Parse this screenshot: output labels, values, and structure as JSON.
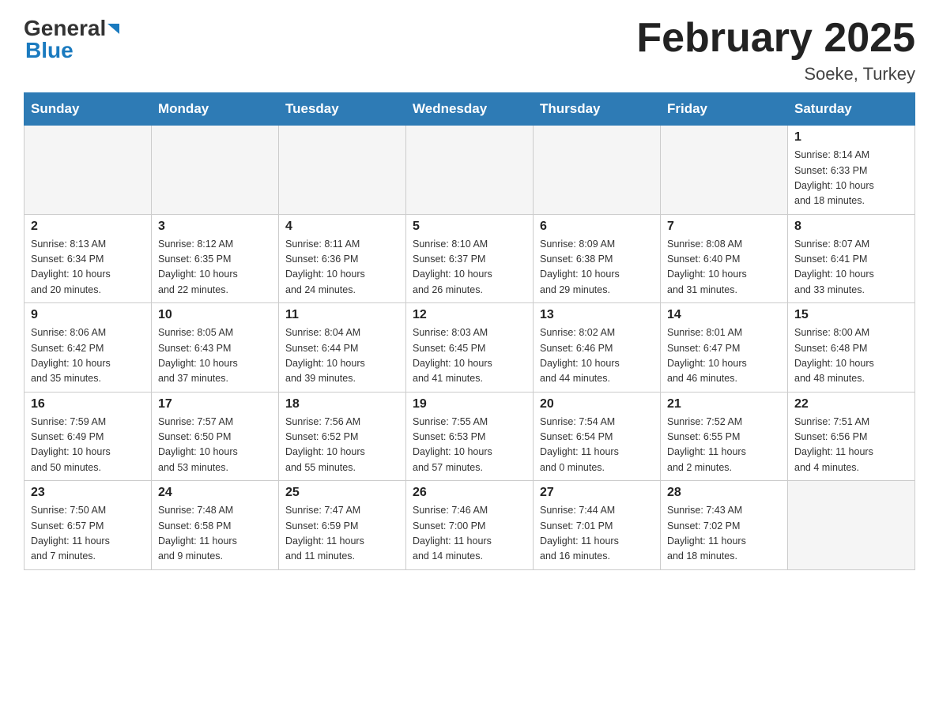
{
  "header": {
    "logo_general": "General",
    "logo_blue": "Blue",
    "month_title": "February 2025",
    "location": "Soeke, Turkey"
  },
  "weekdays": [
    "Sunday",
    "Monday",
    "Tuesday",
    "Wednesday",
    "Thursday",
    "Friday",
    "Saturday"
  ],
  "weeks": [
    [
      {
        "day": "",
        "info": ""
      },
      {
        "day": "",
        "info": ""
      },
      {
        "day": "",
        "info": ""
      },
      {
        "day": "",
        "info": ""
      },
      {
        "day": "",
        "info": ""
      },
      {
        "day": "",
        "info": ""
      },
      {
        "day": "1",
        "info": "Sunrise: 8:14 AM\nSunset: 6:33 PM\nDaylight: 10 hours\nand 18 minutes."
      }
    ],
    [
      {
        "day": "2",
        "info": "Sunrise: 8:13 AM\nSunset: 6:34 PM\nDaylight: 10 hours\nand 20 minutes."
      },
      {
        "day": "3",
        "info": "Sunrise: 8:12 AM\nSunset: 6:35 PM\nDaylight: 10 hours\nand 22 minutes."
      },
      {
        "day": "4",
        "info": "Sunrise: 8:11 AM\nSunset: 6:36 PM\nDaylight: 10 hours\nand 24 minutes."
      },
      {
        "day": "5",
        "info": "Sunrise: 8:10 AM\nSunset: 6:37 PM\nDaylight: 10 hours\nand 26 minutes."
      },
      {
        "day": "6",
        "info": "Sunrise: 8:09 AM\nSunset: 6:38 PM\nDaylight: 10 hours\nand 29 minutes."
      },
      {
        "day": "7",
        "info": "Sunrise: 8:08 AM\nSunset: 6:40 PM\nDaylight: 10 hours\nand 31 minutes."
      },
      {
        "day": "8",
        "info": "Sunrise: 8:07 AM\nSunset: 6:41 PM\nDaylight: 10 hours\nand 33 minutes."
      }
    ],
    [
      {
        "day": "9",
        "info": "Sunrise: 8:06 AM\nSunset: 6:42 PM\nDaylight: 10 hours\nand 35 minutes."
      },
      {
        "day": "10",
        "info": "Sunrise: 8:05 AM\nSunset: 6:43 PM\nDaylight: 10 hours\nand 37 minutes."
      },
      {
        "day": "11",
        "info": "Sunrise: 8:04 AM\nSunset: 6:44 PM\nDaylight: 10 hours\nand 39 minutes."
      },
      {
        "day": "12",
        "info": "Sunrise: 8:03 AM\nSunset: 6:45 PM\nDaylight: 10 hours\nand 41 minutes."
      },
      {
        "day": "13",
        "info": "Sunrise: 8:02 AM\nSunset: 6:46 PM\nDaylight: 10 hours\nand 44 minutes."
      },
      {
        "day": "14",
        "info": "Sunrise: 8:01 AM\nSunset: 6:47 PM\nDaylight: 10 hours\nand 46 minutes."
      },
      {
        "day": "15",
        "info": "Sunrise: 8:00 AM\nSunset: 6:48 PM\nDaylight: 10 hours\nand 48 minutes."
      }
    ],
    [
      {
        "day": "16",
        "info": "Sunrise: 7:59 AM\nSunset: 6:49 PM\nDaylight: 10 hours\nand 50 minutes."
      },
      {
        "day": "17",
        "info": "Sunrise: 7:57 AM\nSunset: 6:50 PM\nDaylight: 10 hours\nand 53 minutes."
      },
      {
        "day": "18",
        "info": "Sunrise: 7:56 AM\nSunset: 6:52 PM\nDaylight: 10 hours\nand 55 minutes."
      },
      {
        "day": "19",
        "info": "Sunrise: 7:55 AM\nSunset: 6:53 PM\nDaylight: 10 hours\nand 57 minutes."
      },
      {
        "day": "20",
        "info": "Sunrise: 7:54 AM\nSunset: 6:54 PM\nDaylight: 11 hours\nand 0 minutes."
      },
      {
        "day": "21",
        "info": "Sunrise: 7:52 AM\nSunset: 6:55 PM\nDaylight: 11 hours\nand 2 minutes."
      },
      {
        "day": "22",
        "info": "Sunrise: 7:51 AM\nSunset: 6:56 PM\nDaylight: 11 hours\nand 4 minutes."
      }
    ],
    [
      {
        "day": "23",
        "info": "Sunrise: 7:50 AM\nSunset: 6:57 PM\nDaylight: 11 hours\nand 7 minutes."
      },
      {
        "day": "24",
        "info": "Sunrise: 7:48 AM\nSunset: 6:58 PM\nDaylight: 11 hours\nand 9 minutes."
      },
      {
        "day": "25",
        "info": "Sunrise: 7:47 AM\nSunset: 6:59 PM\nDaylight: 11 hours\nand 11 minutes."
      },
      {
        "day": "26",
        "info": "Sunrise: 7:46 AM\nSunset: 7:00 PM\nDaylight: 11 hours\nand 14 minutes."
      },
      {
        "day": "27",
        "info": "Sunrise: 7:44 AM\nSunset: 7:01 PM\nDaylight: 11 hours\nand 16 minutes."
      },
      {
        "day": "28",
        "info": "Sunrise: 7:43 AM\nSunset: 7:02 PM\nDaylight: 11 hours\nand 18 minutes."
      },
      {
        "day": "",
        "info": ""
      }
    ]
  ]
}
